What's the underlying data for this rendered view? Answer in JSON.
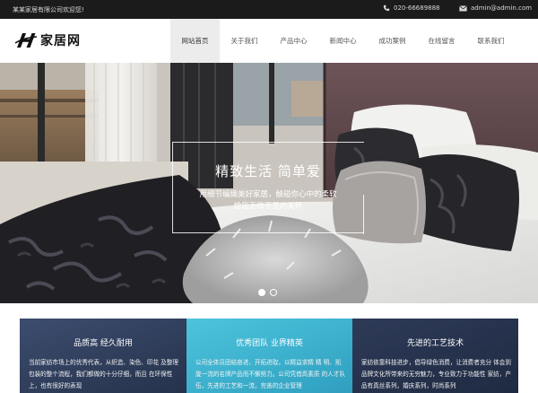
{
  "topbar": {
    "welcome": "某某家居有限公司欢迎您!",
    "phone": "020-66689888",
    "email": "admin@admin.com"
  },
  "header": {
    "logo_text": "家居网",
    "nav": [
      {
        "label": "网站首页",
        "active": true
      },
      {
        "label": "关于我们",
        "active": false
      },
      {
        "label": "产品中心",
        "active": false
      },
      {
        "label": "新闻中心",
        "active": false
      },
      {
        "label": "成功案例",
        "active": false
      },
      {
        "label": "在线留言",
        "active": false
      },
      {
        "label": "联系我们",
        "active": false
      }
    ]
  },
  "hero": {
    "title": "精致生活  简单爱",
    "subtitle_line1": "用细节编織美好家居，触碰你心中的柔软",
    "subtitle_line2": "给您无微不至的关怀",
    "slides_total": 2,
    "active_slide": 1
  },
  "features": [
    {
      "title": "品质高 经久耐用",
      "body": "当前家纺市场上的优秀代表，从织造、染色、印花 及整理包装的整个流程，我们都做的十分仔细，而且 在环保性上，也有很好的表现"
    },
    {
      "title": "优秀团队 业界精英",
      "body": "公司全体员团结奋进、开拓进取，以精益求精 精 明、凯旋一流的名牌产品而不懈努力。公司凭借高素质 的人才队伍，先进的工艺和一流，完善的企业管理"
    },
    {
      "title": "先进的工艺技术",
      "body": "家纺依靠科技进步，倡导绿色消费，让消费者充分 体会到品牌文化所带来的无穷魅力，专业致力于功能性 家纺，产品有真丝系列，婚庆系列，时尚系列"
    }
  ],
  "colors": {
    "topbar_bg": "#1b1b1b",
    "nav_active_bg": "#ececec",
    "feature_dark": "#2e3b58",
    "feature_cyan": "#4dc4dc"
  }
}
